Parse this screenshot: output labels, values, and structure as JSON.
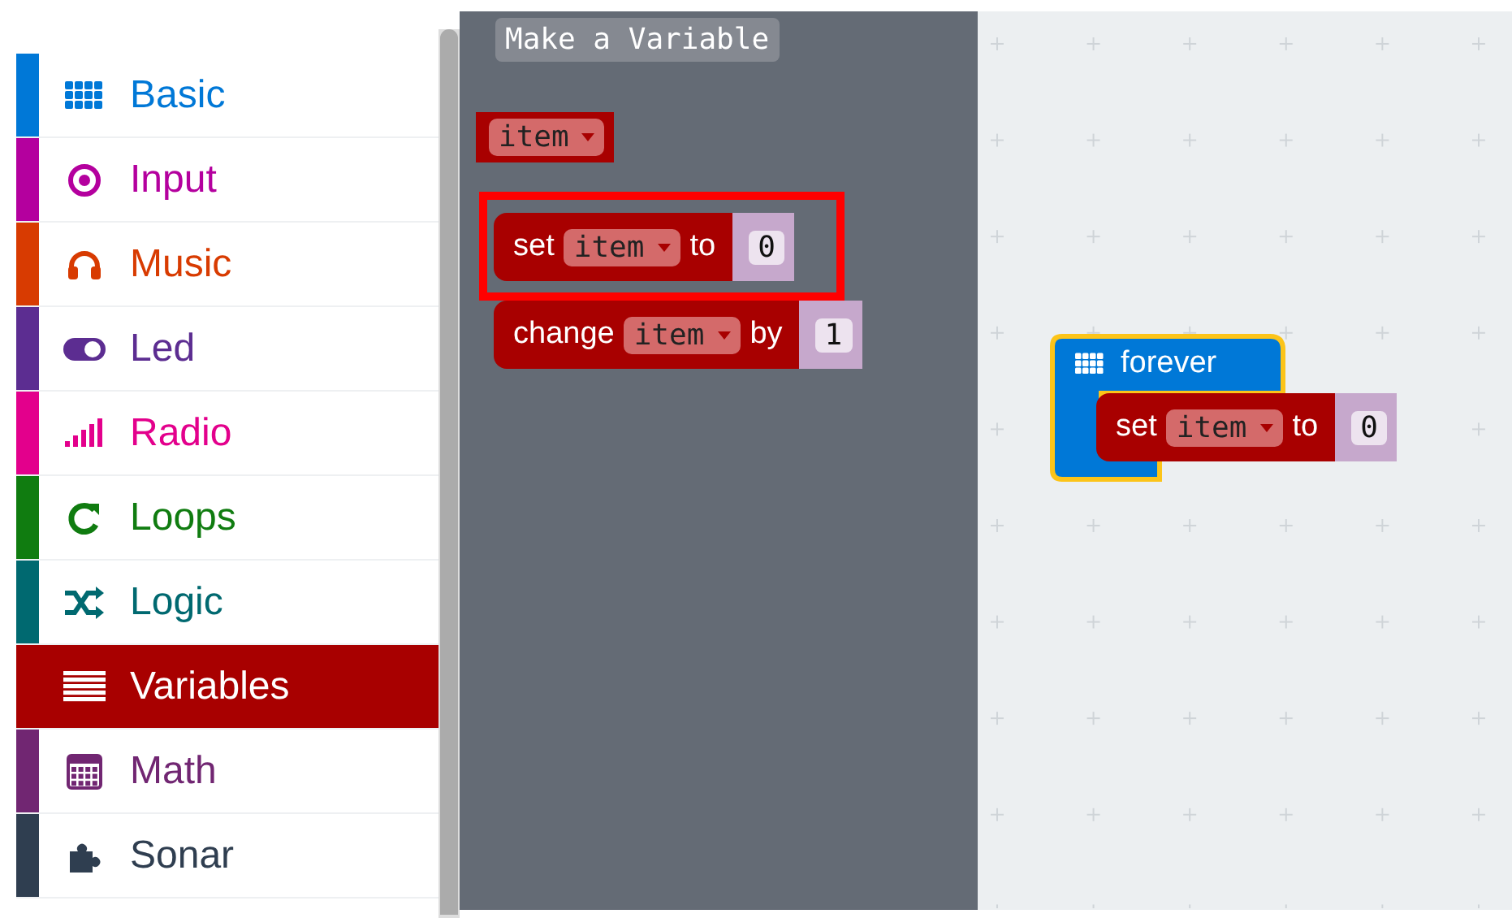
{
  "categories": [
    {
      "label": "Basic",
      "kind": "grid",
      "color": "#0078d7",
      "selected": false
    },
    {
      "label": "Input",
      "kind": "target",
      "color": "#b4009e",
      "selected": false
    },
    {
      "label": "Music",
      "kind": "headphones",
      "color": "#d83b01",
      "selected": false
    },
    {
      "label": "Led",
      "kind": "toggle",
      "color": "#5c2d91",
      "selected": false
    },
    {
      "label": "Radio",
      "kind": "signal",
      "color": "#e3008c",
      "selected": false
    },
    {
      "label": "Loops",
      "kind": "refresh",
      "color": "#107c10",
      "selected": false
    },
    {
      "label": "Logic",
      "kind": "shuffle",
      "color": "#006970",
      "selected": false
    },
    {
      "label": "Variables",
      "kind": "lines",
      "color": "#a80000",
      "selected": true
    },
    {
      "label": "Math",
      "kind": "calculator",
      "color": "#712672",
      "selected": false
    },
    {
      "label": "Sonar",
      "kind": "puzzle",
      "color": "#2f3e50",
      "selected": false
    }
  ],
  "flyout": {
    "button": "Make a Variable",
    "blocks": [
      {
        "kind": "variable",
        "dropdown": "item",
        "highlighted": false
      },
      {
        "kind": "set",
        "words": [
          "set",
          "to"
        ],
        "dropdown": "item",
        "value": "0",
        "highlighted": true
      },
      {
        "kind": "change",
        "words": [
          "change",
          "by"
        ],
        "dropdown": "item",
        "value": "1",
        "highlighted": false
      }
    ]
  },
  "workspace": {
    "blocks": [
      {
        "kind": "forever",
        "label": "forever",
        "children": [
          {
            "kind": "set",
            "words": [
              "set",
              "to"
            ],
            "dropdown": "item",
            "value": "0"
          }
        ]
      }
    ]
  }
}
